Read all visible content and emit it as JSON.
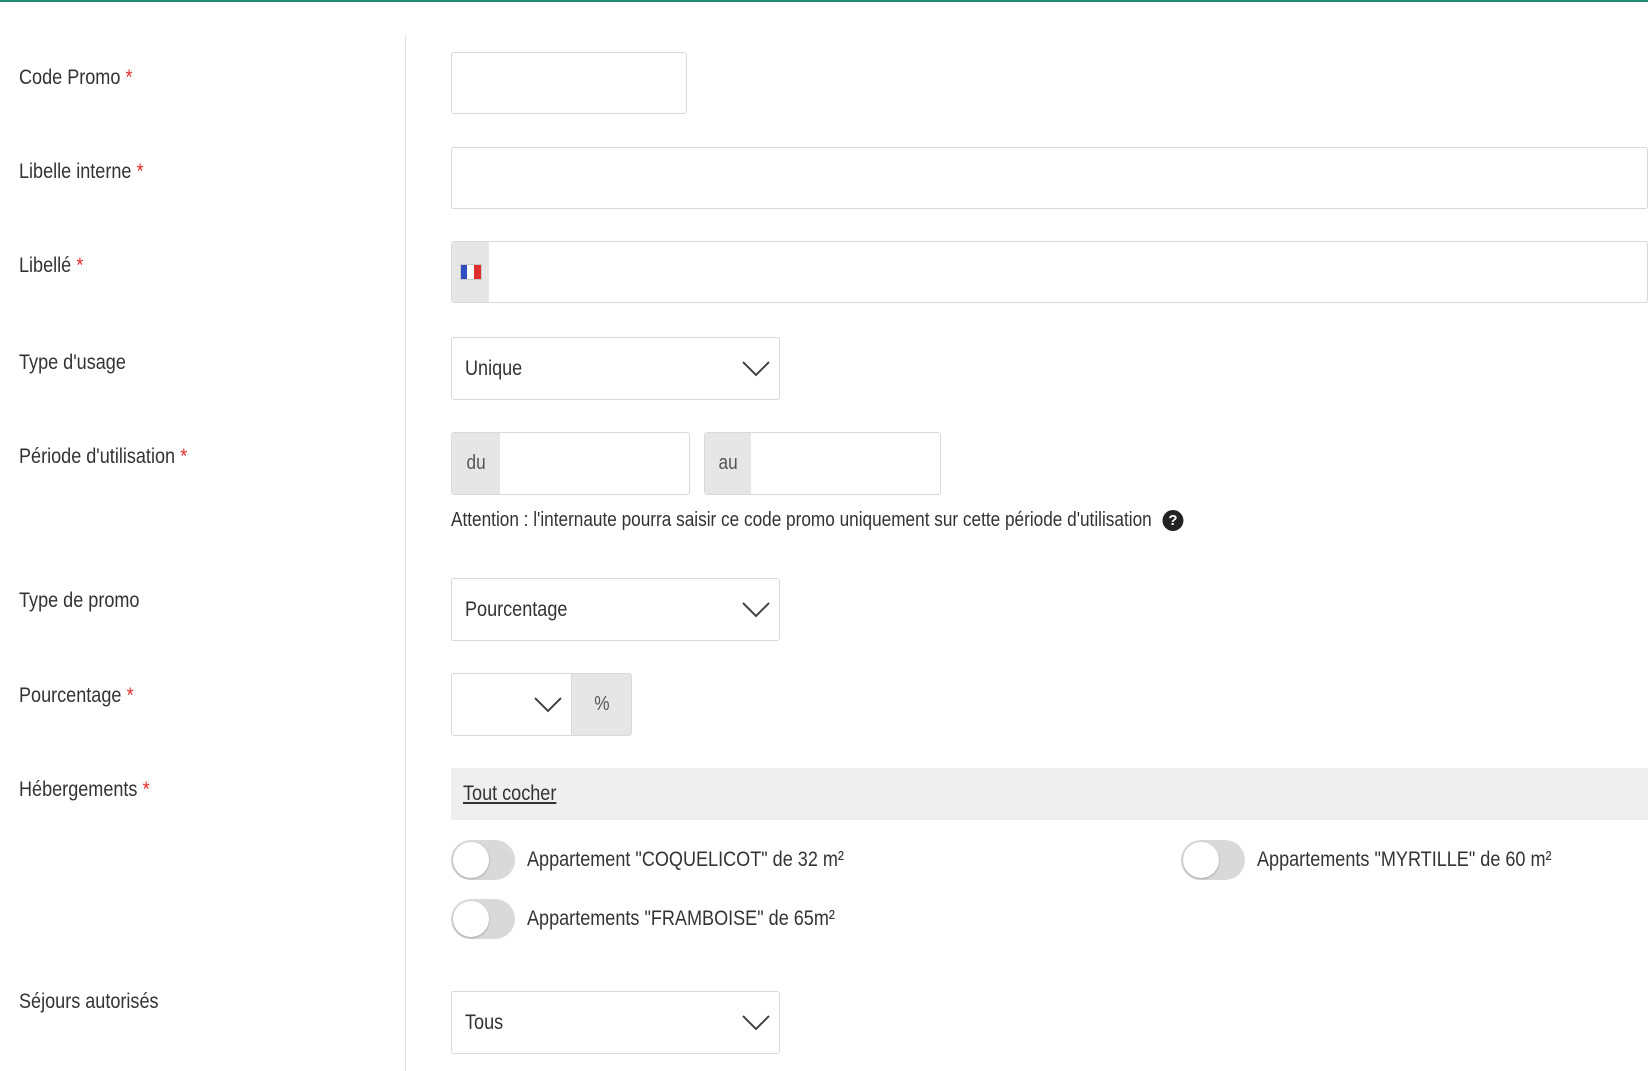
{
  "form": {
    "code_promo": {
      "label": "Code Promo",
      "required_mark": "*",
      "value": ""
    },
    "libelle_interne": {
      "label": "Libelle interne",
      "required_mark": "*",
      "value": ""
    },
    "libelle": {
      "label": "Libellé",
      "required_mark": "*",
      "value": "",
      "flag_icon": "france-flag-icon"
    },
    "type_usage": {
      "label": "Type d'usage",
      "selected": "Unique"
    },
    "periode": {
      "label": "Période d'utilisation",
      "required_mark": "*",
      "du_label": "du",
      "au_label": "au",
      "du_value": "",
      "au_value": "",
      "note": "Attention : l'internaute pourra saisir ce code promo uniquement sur cette période d'utilisation",
      "help_icon": "question-circle-icon",
      "help_glyph": "?"
    },
    "type_promo": {
      "label": "Type de promo",
      "selected": "Pourcentage"
    },
    "pourcentage": {
      "label": "Pourcentage",
      "required_mark": "*",
      "selected": "",
      "unit": "%"
    },
    "hebergements": {
      "label": "Hébergements",
      "required_mark": "*",
      "toggle_all_label": "Tout cocher",
      "items": [
        {
          "label": "Appartement \"COQUELICOT\" de 32 m²",
          "checked": false
        },
        {
          "label": "Appartements \"MYRTILLE\" de 60 m²",
          "checked": false
        },
        {
          "label": "Appartements \"FRAMBOISE\" de 65m²",
          "checked": false
        }
      ]
    },
    "sejours": {
      "label": "Séjours autorisés",
      "selected": "Tous"
    }
  },
  "colors": {
    "accent_top_line": "#1f8a70",
    "required": "#e02d2d",
    "addon_bg": "#e6e6e6",
    "toggle_off": "#d9d9d9"
  }
}
